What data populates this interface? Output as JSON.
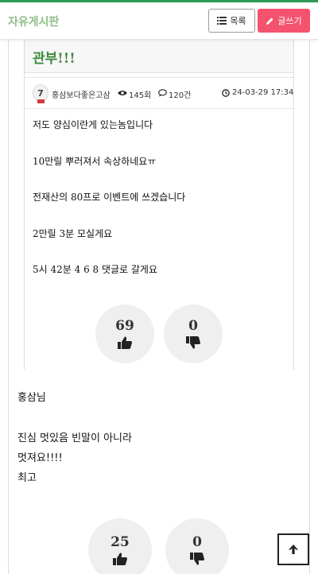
{
  "header": {
    "board_title": "자유게시판",
    "list_label": "목록",
    "write_label": "글쓰기",
    "accent_color": "#2e9b57",
    "write_color": "#f3536e"
  },
  "post": {
    "title": "관부!!!",
    "author": "홍삼보다좋은고삼",
    "author_level": "7",
    "views": "145회",
    "comments": "120건",
    "date": "24-03-29 17:34",
    "body": [
      "저도 양심이란게 있는놈입니다",
      "10만릴 뿌러져서 속상하네요ㅠ",
      "전재산의 80프로 이벤트에 쓰겠습니다",
      "2만릴 3분 모실게요",
      "5시 42분 4 6 8 댓글로 갈게요"
    ],
    "likes": "69",
    "dislikes": "0"
  },
  "comment": {
    "lines": [
      "홍삼님",
      "",
      "진심 멋있음 빈말이 아니라",
      "멋져요!!!!",
      "최고"
    ],
    "likes": "25",
    "dislikes": "0"
  },
  "icons": {
    "list": "list-icon",
    "write": "pencil-icon",
    "views": "eye-icon",
    "comments": "speech-bubble-icon",
    "date": "clock-icon",
    "like": "thumbs-up-icon",
    "dislike": "thumbs-down-icon",
    "top": "arrow-up-icon"
  }
}
